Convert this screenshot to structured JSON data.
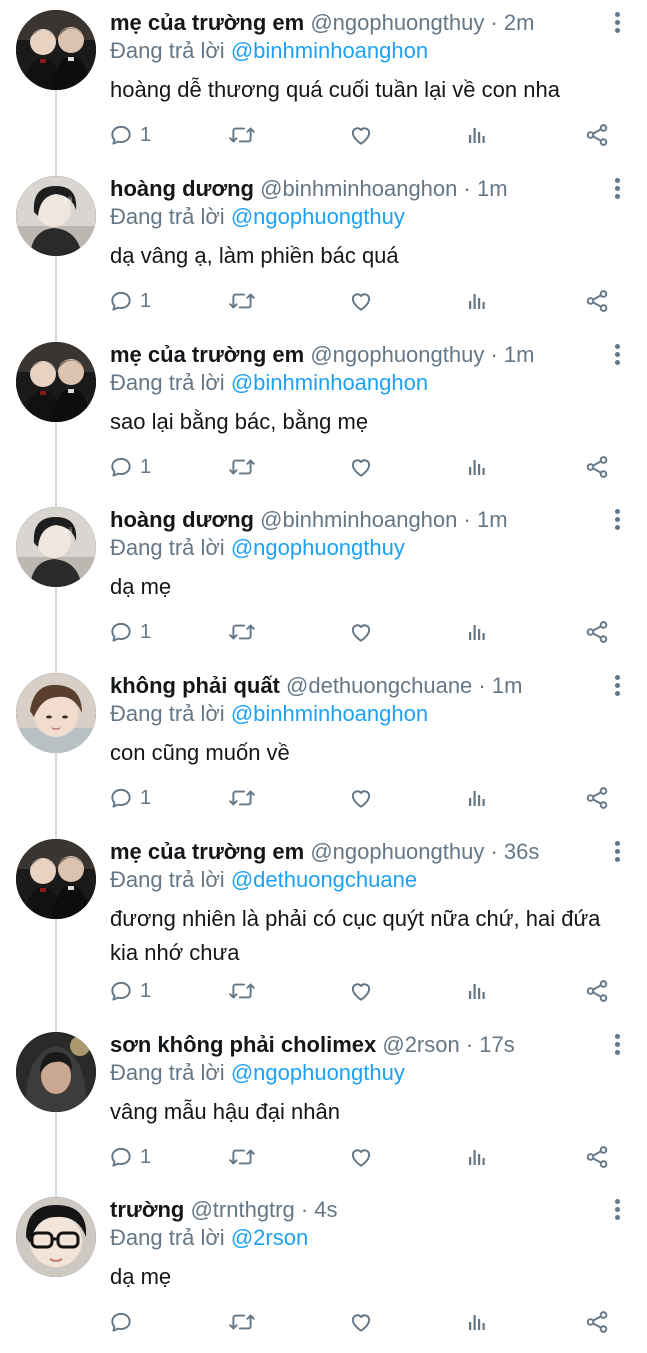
{
  "reply_prefix": "Đang trả lời",
  "tweets": [
    {
      "name": "mẹ của trường em",
      "handle": "@ngophuongthuy",
      "time": "2m",
      "reply_to": "@binhminhoanghon",
      "text": "hoàng dễ thương quá cuối tuần lại về con nha",
      "replies": "1",
      "avatar": "avatar-couple"
    },
    {
      "name": "hoàng dương",
      "handle": "@binhminhoanghon",
      "time": "1m",
      "reply_to": "@ngophuongthuy",
      "text": "dạ vâng ạ, làm phiền bác quá",
      "replies": "1",
      "avatar": "avatar-boy"
    },
    {
      "name": "mẹ của trường em",
      "handle": "@ngophuongthuy",
      "time": "1m",
      "reply_to": "@binhminhoanghon",
      "text": "sao lại bằng bác, bằng mẹ",
      "replies": "1",
      "avatar": "avatar-couple"
    },
    {
      "name": "hoàng dương",
      "handle": "@binhminhoanghon",
      "time": "1m",
      "reply_to": "@ngophuongthuy",
      "text": "dạ mẹ",
      "replies": "1",
      "avatar": "avatar-boy"
    },
    {
      "name": "không phải quất",
      "handle": "@dethuongchuane",
      "time": "1m",
      "reply_to": "@binhminhoanghon",
      "text": "con cũng muốn về",
      "replies": "1",
      "avatar": "avatar-face"
    },
    {
      "name": "mẹ của trường em",
      "handle": "@ngophuongthuy",
      "time": "36s",
      "reply_to": "@dethuongchuane",
      "text": "đương nhiên là phải có cục quýt nữa chứ, hai đứa kia nhớ chưa",
      "replies": "1",
      "avatar": "avatar-couple"
    },
    {
      "name": "sơn không phải cholimex",
      "handle": "@2rson",
      "time": "17s",
      "reply_to": "@ngophuongthuy",
      "text": "vâng mẫu hậu đại nhân",
      "replies": "1",
      "avatar": "avatar-hood"
    },
    {
      "name": "trường",
      "handle": "@trnthgtrg",
      "time": "4s",
      "reply_to": "@2rson",
      "text": "dạ mẹ",
      "replies": "",
      "avatar": "avatar-glasses"
    }
  ]
}
